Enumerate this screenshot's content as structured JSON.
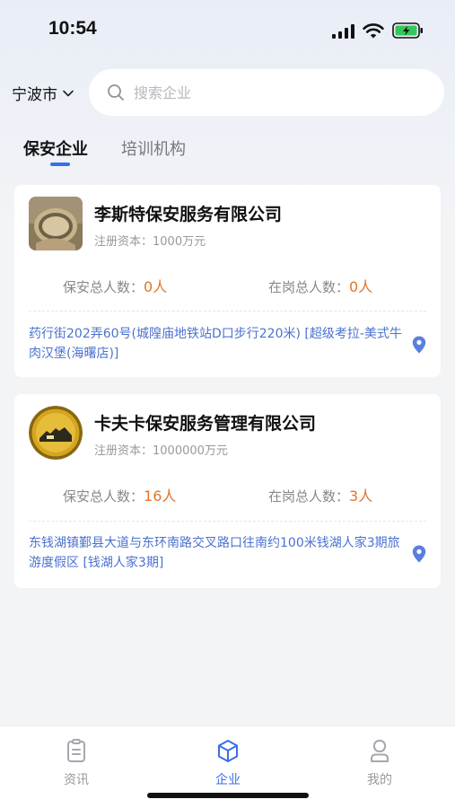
{
  "status_bar": {
    "time": "10:54"
  },
  "header": {
    "city": "宁波市",
    "search_placeholder": "搜索企业"
  },
  "tabs": [
    {
      "label": "保安企业",
      "active": true
    },
    {
      "label": "培训机构",
      "active": false
    }
  ],
  "companies": [
    {
      "name": "李斯特保安服务有限公司",
      "capital_label": "注册资本：",
      "capital_value": "1000万元",
      "guard_total_label": "保安总人数：",
      "guard_total": "0人",
      "on_duty_label": "在岗总人数：",
      "on_duty": "0人",
      "address": "药行街202弄60号(城隍庙地铁站D口步行220米) [超级考拉-美式牛肉汉堡(海曙店)]"
    },
    {
      "name": "卡夫卡保安服务管理有限公司",
      "capital_label": "注册资本：",
      "capital_value": "1000000万元",
      "guard_total_label": "保安总人数：",
      "guard_total": "16人",
      "on_duty_label": "在岗总人数：",
      "on_duty": "3人",
      "address": "东钱湖镇鄞县大道与东环南路交叉路口往南约100米钱湖人家3期旅游度假区 [钱湖人家3期]"
    }
  ],
  "bottom_nav": [
    {
      "label": "资讯",
      "icon": "news-icon",
      "active": false
    },
    {
      "label": "企业",
      "icon": "enterprise-icon",
      "active": true
    },
    {
      "label": "我的",
      "icon": "profile-icon",
      "active": false
    }
  ],
  "colors": {
    "accent": "#3a6ee8",
    "highlight": "#e2752b",
    "address": "#4b72d0"
  }
}
